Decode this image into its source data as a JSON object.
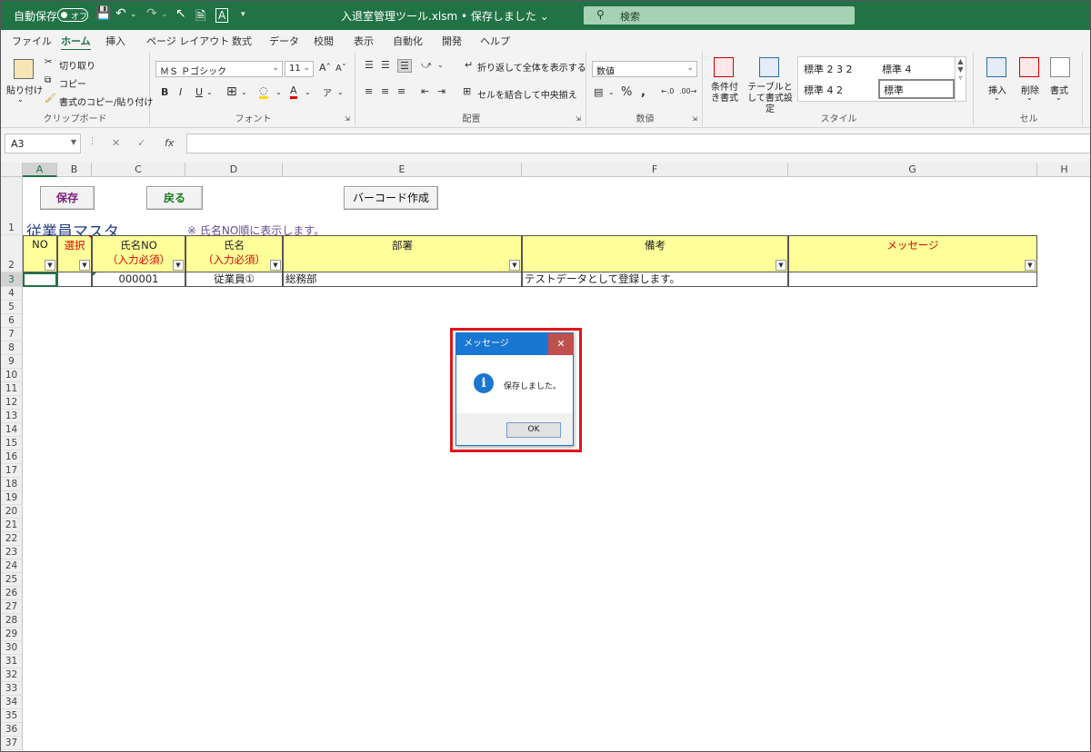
{
  "titlebar": {
    "autosave_label": "自動保存",
    "autosave_state": "オフ",
    "filename": "入退室管理ツール.xlsm • 保存しました ⌄",
    "search_placeholder": "検索"
  },
  "menu": {
    "tabs": [
      "ファイル",
      "ホーム",
      "挿入",
      "ページ レイアウト",
      "数式",
      "データ",
      "校閲",
      "表示",
      "自動化",
      "開発",
      "ヘルプ"
    ],
    "active_tab": "ホーム"
  },
  "ribbon": {
    "clipboard": {
      "paste": "貼り付け",
      "cut": "切り取り",
      "copy": "コピー",
      "format_painter": "書式のコピー/貼り付け",
      "label": "クリップボード"
    },
    "font": {
      "font_name": "ＭＳ Ｐゴシック",
      "font_size": "11",
      "label": "フォント"
    },
    "alignment": {
      "wrap_text": "折り返して全体を表示する",
      "merge_center": "セルを結合して中央揃え",
      "label": "配置"
    },
    "number": {
      "format": "数値",
      "label": "数値"
    },
    "styles": {
      "conditional": "条件付き書式",
      "table": "テーブルとして書式設定",
      "style1": "標準 2 3 2",
      "style2": "標準 4",
      "style3": "標準 4 2",
      "style4": "標準",
      "label": "スタイル"
    },
    "cells": {
      "insert": "挿入",
      "delete": "削除",
      "format": "書式",
      "label": "セル"
    }
  },
  "formula_bar": {
    "name_box": "A3",
    "fx": "fx",
    "value": ""
  },
  "grid": {
    "columns": [
      "A",
      "B",
      "C",
      "D",
      "E",
      "F",
      "G",
      "H"
    ],
    "rows": [
      "1",
      "2",
      "3",
      "4",
      "5",
      "6",
      "7",
      "8",
      "9",
      "10",
      "11",
      "12",
      "13",
      "14",
      "15",
      "16",
      "17",
      "18",
      "19",
      "20",
      "21",
      "22",
      "23",
      "24",
      "25",
      "26",
      "27",
      "28",
      "29",
      "30",
      "31",
      "32",
      "33",
      "34",
      "35",
      "36",
      "37"
    ]
  },
  "sheet": {
    "buttons": {
      "save": "保存",
      "back": "戻る",
      "barcode": "バーコード作成"
    },
    "title": "従業員マスタ",
    "note": "※ 氏名NO順に表示します。",
    "headers": {
      "no": "NO",
      "select": "選択",
      "employee_no": "氏名NO",
      "employee_no_req": "（入力必須）",
      "name": "氏名",
      "name_req": "（入力必須）",
      "department": "部署",
      "remarks": "備考",
      "message": "メッセージ"
    },
    "row": {
      "no": "",
      "select": "",
      "employee_no": "000001",
      "name": "従業員①",
      "department": "総務部",
      "remarks": "テストデータとして登録します。",
      "message": ""
    }
  },
  "dialog": {
    "title": "メッセージ",
    "message": "保存しました。",
    "ok": "OK"
  }
}
